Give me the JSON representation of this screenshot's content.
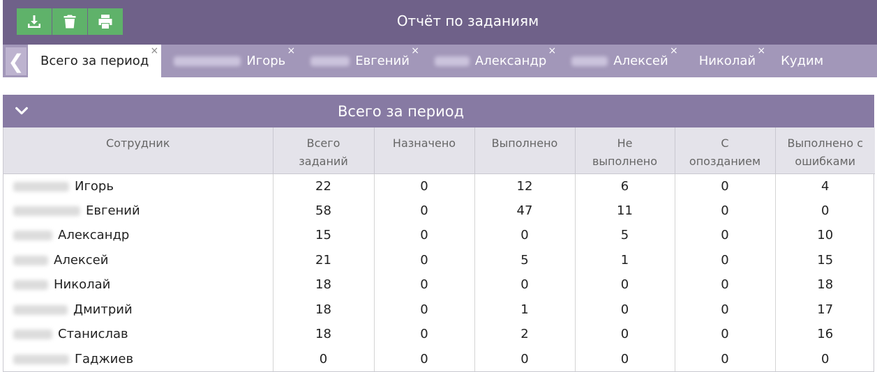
{
  "app": {
    "title": "Отчёт по заданиям"
  },
  "toolbar": {
    "download_icon": "download-icon",
    "delete_icon": "trash-icon",
    "print_icon": "printer-icon",
    "button_color": "#5fb26a"
  },
  "tabs": [
    {
      "label": "Всего за период",
      "active": true
    },
    {
      "label": "Игорь",
      "blurred_prefix": true
    },
    {
      "label": "Евгений",
      "blurred_prefix": true
    },
    {
      "label": "Александр",
      "blurred_prefix": true
    },
    {
      "label": "Алексей",
      "blurred_prefix": true
    },
    {
      "label": "Николай",
      "blurred_prefix": true
    },
    {
      "label": "Кудим"
    }
  ],
  "tab_close_glyph": "×",
  "tab_prev_glyph": "❮",
  "panel": {
    "title": "Всего за период",
    "collapse_icon": "chevron-down-icon"
  },
  "table": {
    "columns": [
      "Сотрудник",
      "Всего заданий",
      "Назначено",
      "Выполнено",
      "Не выполнено",
      "С опозданием",
      "Выполнено с ошибками"
    ],
    "rows": [
      {
        "employee": "Игорь",
        "values": [
          22,
          0,
          12,
          6,
          0,
          4
        ]
      },
      {
        "employee": "Евгений",
        "values": [
          58,
          0,
          47,
          11,
          0,
          0
        ]
      },
      {
        "employee": "Александр",
        "values": [
          15,
          0,
          0,
          5,
          0,
          10
        ]
      },
      {
        "employee": "Алексей",
        "values": [
          21,
          0,
          5,
          1,
          0,
          15
        ]
      },
      {
        "employee": "Николай",
        "values": [
          18,
          0,
          0,
          0,
          0,
          18
        ]
      },
      {
        "employee": "Дмитрий",
        "values": [
          18,
          0,
          1,
          0,
          0,
          17
        ]
      },
      {
        "employee": "Станислав",
        "values": [
          18,
          0,
          2,
          0,
          0,
          16
        ]
      },
      {
        "employee": "Гаджиев",
        "values": [
          0,
          0,
          0,
          0,
          0,
          0
        ]
      }
    ]
  },
  "colors": {
    "titlebar": "#6f6189",
    "tabbar": "#a297b9",
    "panel_header": "#877aa3",
    "table_header": "#e4e3ea"
  }
}
